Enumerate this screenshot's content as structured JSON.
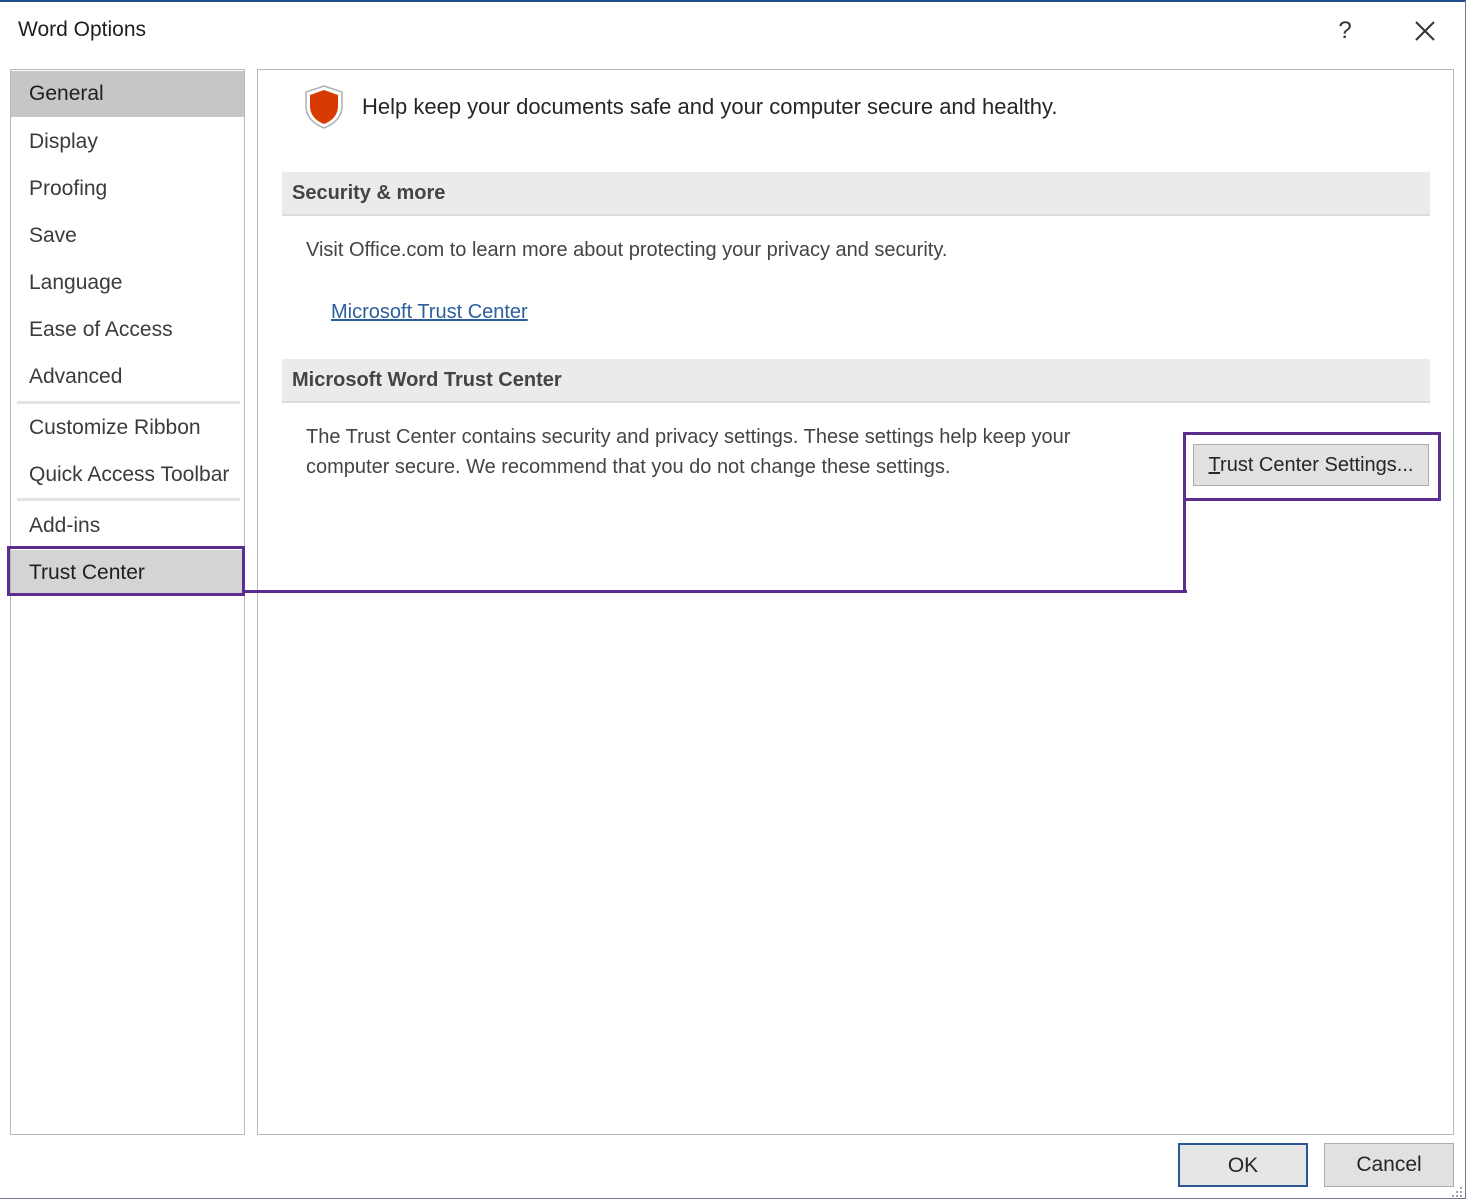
{
  "window": {
    "title": "Word Options",
    "help_label": "?"
  },
  "sidebar": {
    "items": [
      {
        "label": "General"
      },
      {
        "label": "Display"
      },
      {
        "label": "Proofing"
      },
      {
        "label": "Save"
      },
      {
        "label": "Language"
      },
      {
        "label": "Ease of Access"
      },
      {
        "label": "Advanced"
      },
      {
        "label": "Customize Ribbon"
      },
      {
        "label": "Quick Access Toolbar"
      },
      {
        "label": "Add-ins"
      },
      {
        "label": "Trust Center"
      }
    ]
  },
  "main": {
    "intro": "Help keep your documents safe and your computer secure and healthy.",
    "security_section": {
      "header": "Security & more",
      "text": "Visit Office.com to learn more about protecting your privacy and security.",
      "link": "Microsoft Trust Center"
    },
    "trust_section": {
      "header": "Microsoft Word Trust Center",
      "text_line1": "The Trust Center contains security and privacy settings. These settings help keep your",
      "text_line2": "computer secure. We recommend that you do not change these settings.",
      "button_accel": "T",
      "button_rest": "rust Center Settings..."
    }
  },
  "footer": {
    "ok_label": "OK",
    "cancel_label": "Cancel"
  },
  "colors": {
    "highlight": "#5b2d91",
    "shield": "#d83b01",
    "link": "#2c5f9e"
  },
  "icons": {
    "shield": "shield-icon",
    "close": "close-icon",
    "help": "help-icon",
    "grip": "resize-grip-icon"
  }
}
